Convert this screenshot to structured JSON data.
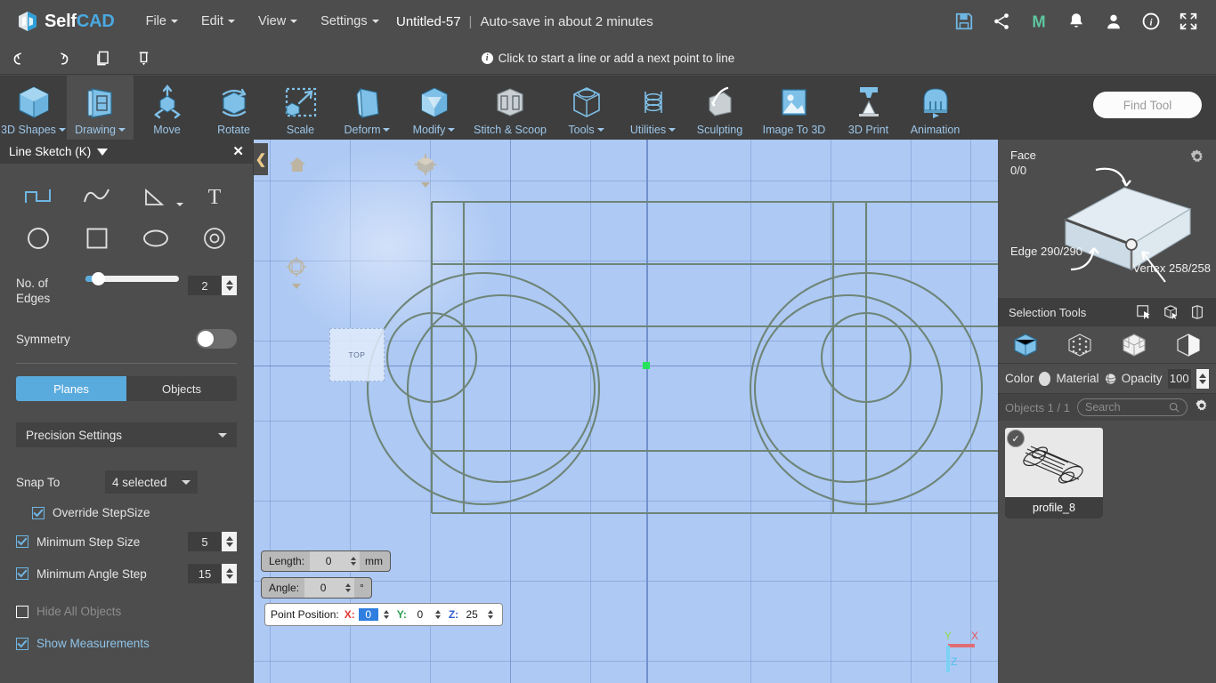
{
  "topbar": {
    "brand_self": "Self",
    "brand_cad": "CAD",
    "menus": [
      {
        "label": "File"
      },
      {
        "label": "Edit"
      },
      {
        "label": "View"
      },
      {
        "label": "Settings"
      }
    ],
    "document_title": "Untitled-57",
    "separator": "|",
    "autosave_text": "Auto-save in about 2 minutes",
    "icons": [
      {
        "name": "save-icon"
      },
      {
        "name": "share-icon"
      },
      {
        "name": "m-logo-icon"
      },
      {
        "name": "notifications-bell-icon"
      },
      {
        "name": "user-account-icon"
      },
      {
        "name": "info-icon"
      },
      {
        "name": "fullscreen-icon"
      }
    ]
  },
  "actionbar": {
    "undo": "undo-icon",
    "redo": "redo-icon",
    "copy": "copy-icon",
    "delete": "delete-icon",
    "hint_text": "Click to start a line or add a next point to line"
  },
  "ribbon": {
    "items": [
      {
        "label": "3D Shapes",
        "dropdown": true,
        "active": false
      },
      {
        "label": "Drawing",
        "dropdown": true,
        "active": true
      },
      {
        "label": "Move",
        "dropdown": false,
        "active": false
      },
      {
        "label": "Rotate",
        "dropdown": false,
        "active": false
      },
      {
        "label": "Scale",
        "dropdown": false,
        "active": false
      },
      {
        "label": "Deform",
        "dropdown": true,
        "active": false
      },
      {
        "label": "Modify",
        "dropdown": true,
        "active": false
      },
      {
        "label": "Stitch & Scoop",
        "dropdown": false,
        "active": false
      },
      {
        "label": "Tools",
        "dropdown": true,
        "active": false
      },
      {
        "label": "Utilities",
        "dropdown": true,
        "active": false
      },
      {
        "label": "Sculpting",
        "dropdown": false,
        "active": false
      },
      {
        "label": "Image To 3D",
        "dropdown": false,
        "active": false
      },
      {
        "label": "3D Print",
        "dropdown": false,
        "active": false
      },
      {
        "label": "Animation",
        "dropdown": false,
        "active": false
      }
    ],
    "find_tool_placeholder": "Find Tool"
  },
  "left_panel": {
    "title": "Line Sketch (K)",
    "close_label": "✕",
    "tools": [
      {
        "name": "polyline-tool",
        "active": true
      },
      {
        "name": "curve-tool",
        "active": false
      },
      {
        "name": "freehand-tool",
        "active": false
      },
      {
        "name": "text-tool",
        "active": false
      },
      {
        "name": "circle-tool",
        "active": false
      },
      {
        "name": "rectangle-tool",
        "active": false
      },
      {
        "name": "ellipse-tool",
        "active": false
      },
      {
        "name": "ring-tool",
        "active": false
      }
    ],
    "edges_label": "No. of Edges",
    "edges_value": "2",
    "symmetry_label": "Symmetry",
    "symmetry_on": false,
    "segmented": {
      "planes_label": "Planes",
      "objects_label": "Objects",
      "active": "Planes"
    },
    "precision_settings_label": "Precision Settings",
    "snap_to_label": "Snap To",
    "snap_to_value": "4 selected",
    "override_stepsize_label": "Override StepSize",
    "override_stepsize_checked": true,
    "min_step_size_label": "Minimum Step Size",
    "min_step_size_checked": true,
    "min_step_size_value": "5",
    "min_angle_step_label": "Minimum Angle Step",
    "min_angle_step_checked": true,
    "min_angle_step_value": "15",
    "hide_all_objects_label": "Hide All Objects",
    "hide_all_objects_checked": false,
    "show_measurements_label": "Show Measurements",
    "show_measurements_checked": true
  },
  "viewport": {
    "plane_label": "TOP",
    "home_icon": "home-icon",
    "viewcube_icon": "view-cube-icon",
    "target_icon": "camera-target-icon",
    "collapse_left_icon": "chevron-left-icon",
    "collapse_right_icon": "chevron-right-icon",
    "length": {
      "label": "Length:",
      "value": "0",
      "unit": "mm"
    },
    "angle": {
      "label": "Angle:",
      "value": "0",
      "unit": "°"
    },
    "point_position": {
      "label": "Point Position:",
      "x_axis": "X:",
      "x_value": "0",
      "y_axis": "Y:",
      "y_value": "0",
      "z_axis": "Z:",
      "z_value": "25"
    },
    "axis_gizmo": {
      "x": "X",
      "y": "Y",
      "z": "Z"
    }
  },
  "right_panel": {
    "face_label": "Face",
    "face_value": "0/0",
    "edge_label": "Edge",
    "edge_value": "290/290",
    "vertex_label": "Vertex",
    "vertex_value": "258/258",
    "settings_gear": "gear-icon",
    "selection_tools_label": "Selection Tools",
    "selection_icons": [
      {
        "name": "rect-select-icon"
      },
      {
        "name": "box-select-icon"
      },
      {
        "name": "lasso-select-icon"
      }
    ],
    "mode_icons": [
      {
        "name": "object-mode-icon",
        "active": true
      },
      {
        "name": "vertex-mode-icon",
        "active": false
      },
      {
        "name": "face-mode-icon",
        "active": false
      },
      {
        "name": "edge-mode-icon",
        "active": false
      }
    ],
    "color_label": "Color",
    "material_label": "Material",
    "opacity_label": "Opacity",
    "opacity_value": "100",
    "objects_title": "Objects 1 / 1",
    "search_placeholder": "Search",
    "objects": [
      {
        "name": "profile_8",
        "selected": true
      }
    ]
  },
  "colors": {
    "chrome_bg": "#4d4d4d",
    "ribbon_bg": "#3e3e3e",
    "accent_blue": "#5aabdd",
    "label_blue": "#9dc6e8",
    "viewport_bg": "#aec9f4",
    "sketch_stroke": "#6e8577",
    "axis_x": "#e53935",
    "axis_y": "#2e9e4f",
    "axis_z": "#2f5fd0",
    "point_marker": "#22e35a"
  }
}
